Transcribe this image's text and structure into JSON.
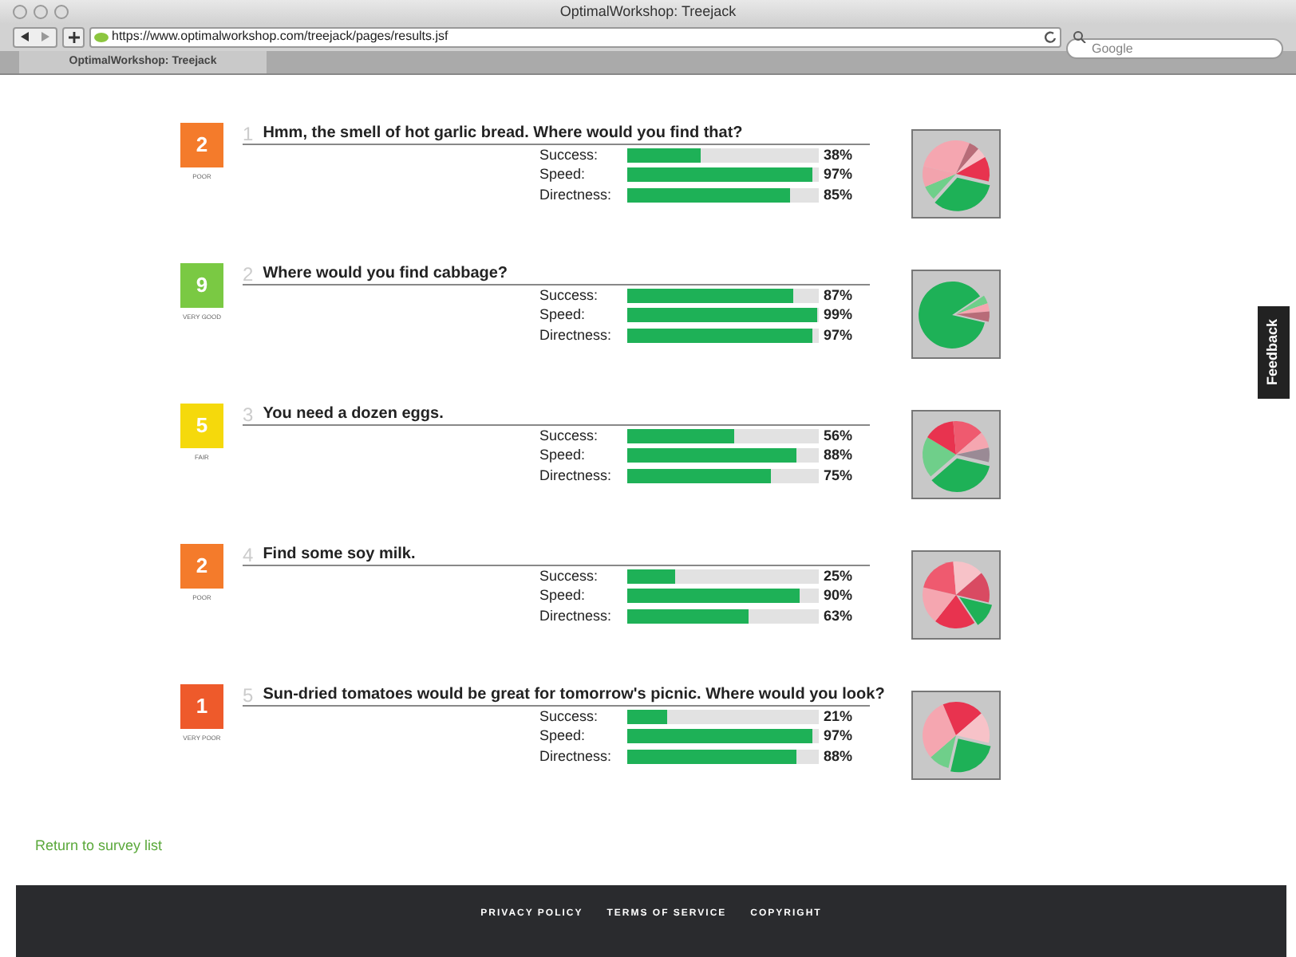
{
  "window": {
    "title": "OptimalWorkshop: Treejack"
  },
  "toolbar": {
    "url": "https://www.optimalworkshop.com/treejack/pages/results.jsf",
    "search_placeholder": "Google"
  },
  "tabs": [
    {
      "label": "OptimalWorkshop: Treejack",
      "selected": true
    }
  ],
  "tasks": [
    {
      "score": "2",
      "rating": "POOR",
      "color": "#f47b2b",
      "number": "1",
      "question": "Hmm, the smell of hot garlic bread. Where would you find that?",
      "metrics": [
        {
          "label": "Success:",
          "level": 0.38,
          "reading": "38%"
        },
        {
          "label": "Speed:",
          "level": 0.97,
          "reading": "97%"
        },
        {
          "label": "Directness:",
          "level": 0.85,
          "reading": "85%"
        }
      ]
    },
    {
      "score": "9",
      "rating": "VERY GOOD",
      "color": "#7ac943",
      "number": "2",
      "question": "Where would you find cabbage?",
      "metrics": [
        {
          "label": "Success:",
          "level": 0.87,
          "reading": "87%"
        },
        {
          "label": "Speed:",
          "level": 0.99,
          "reading": "99%"
        },
        {
          "label": "Directness:",
          "level": 0.97,
          "reading": "97%"
        }
      ]
    },
    {
      "score": "5",
      "rating": "FAIR",
      "color": "#f5d90c",
      "number": "3",
      "question": "You need a dozen eggs.",
      "metrics": [
        {
          "label": "Success:",
          "level": 0.56,
          "reading": "56%"
        },
        {
          "label": "Speed:",
          "level": 0.88,
          "reading": "88%"
        },
        {
          "label": "Directness:",
          "level": 0.75,
          "reading": "75%"
        }
      ]
    },
    {
      "score": "2",
      "rating": "POOR",
      "color": "#f47b2b",
      "number": "4",
      "question": "Find some soy milk.",
      "metrics": [
        {
          "label": "Success:",
          "level": 0.25,
          "reading": "25%"
        },
        {
          "label": "Speed:",
          "level": 0.9,
          "reading": "90%"
        },
        {
          "label": "Directness:",
          "level": 0.63,
          "reading": "63%"
        }
      ]
    },
    {
      "score": "1",
      "rating": "VERY POOR",
      "color": "#ee5a2b",
      "number": "5",
      "question": "Sun-dried tomatoes would be great for tomorrow's picnic. Where would you look?",
      "metrics": [
        {
          "label": "Success:",
          "level": 0.21,
          "reading": "21%"
        },
        {
          "label": "Speed:",
          "level": 0.97,
          "reading": "97%"
        },
        {
          "label": "Directness:",
          "level": 0.88,
          "reading": "88%"
        }
      ]
    }
  ],
  "return_link": "Return to survey list",
  "feedback_tab": "Feedback",
  "footer_links": [
    "PRIVACY POLICY",
    "TERMS OF SERVICE",
    "COPYRIGHT"
  ]
}
